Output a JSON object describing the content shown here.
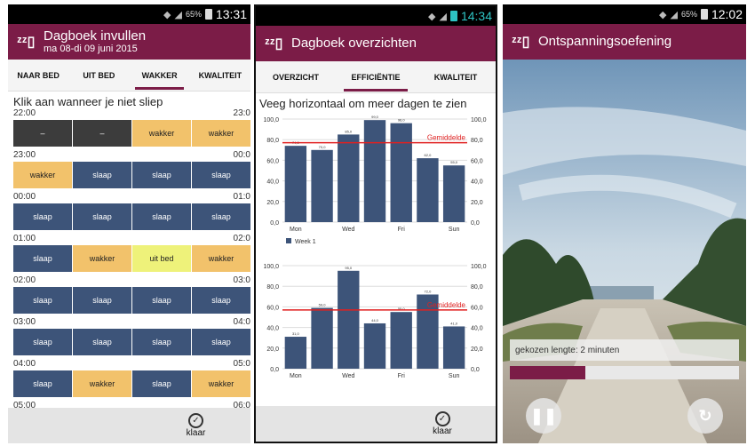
{
  "screen1": {
    "status": {
      "battery_pct": "65%",
      "time": "13:31"
    },
    "appbar": {
      "title": "Dagboek invullen",
      "subtitle": "ma 08-di 09 juni 2015"
    },
    "tabs": [
      "NAAR BED",
      "UIT BED",
      "WAKKER",
      "KWALITEIT"
    ],
    "active_tab": 2,
    "instruction": "Klik aan wanneer je niet sliep",
    "hours": [
      {
        "start": "22:00",
        "end": "23:0",
        "blocks": [
          "–",
          "–",
          "wakker",
          "wakker"
        ]
      },
      {
        "start": "23:00",
        "end": "00:0",
        "blocks": [
          "wakker",
          "slaap",
          "slaap",
          "slaap"
        ]
      },
      {
        "start": "00:00",
        "end": "01:0",
        "blocks": [
          "slaap",
          "slaap",
          "slaap",
          "slaap"
        ]
      },
      {
        "start": "01:00",
        "end": "02:0",
        "blocks": [
          "slaap",
          "wakker",
          "uit bed",
          "wakker"
        ]
      },
      {
        "start": "02:00",
        "end": "03:0",
        "blocks": [
          "slaap",
          "slaap",
          "slaap",
          "slaap"
        ]
      },
      {
        "start": "03:00",
        "end": "04:0",
        "blocks": [
          "slaap",
          "slaap",
          "slaap",
          "slaap"
        ]
      },
      {
        "start": "04:00",
        "end": "05:0",
        "blocks": [
          "slaap",
          "wakker",
          "slaap",
          "wakker"
        ]
      },
      {
        "start": "05:00",
        "end": "06:0",
        "blocks": []
      }
    ],
    "done_label": "klaar"
  },
  "screen2": {
    "status": {
      "time": "14:34"
    },
    "appbar": {
      "title": "Dagboek overzichten"
    },
    "tabs": [
      "OVERZICHT",
      "EFFICIËNTIE",
      "KWALITEIT"
    ],
    "active_tab": 1,
    "instruction": "Veeg horizontaal om meer dagen te zien",
    "done_label": "klaar"
  },
  "chart_data": [
    {
      "type": "bar",
      "categories": [
        "Mon",
        "Tue",
        "Wed",
        "Thu",
        "Fri",
        "Sat",
        "Sun"
      ],
      "tick_labels": [
        "Mon",
        "Wed",
        "Fri",
        "Sun"
      ],
      "series": [
        {
          "name": "Week 1",
          "values": [
            74.0,
            70.0,
            85.0,
            99.0,
            96.0,
            62.0,
            55.0
          ]
        }
      ],
      "value_labels": [
        "74,0",
        "70,0",
        "85,0",
        "99,0",
        "96,0",
        "62,0",
        "55,0"
      ],
      "reference_line": {
        "label": "Gemiddelde",
        "value": 77,
        "color": "#e02020"
      },
      "ylim": [
        0,
        100
      ],
      "yticks": [
        "0,0",
        "20,0",
        "40,0",
        "60,0",
        "80,0",
        "100,0"
      ],
      "grid": true,
      "legend": "bottom-left"
    },
    {
      "type": "bar",
      "categories": [
        "Mon",
        "Tue",
        "Wed",
        "Thu",
        "Fri",
        "Sat",
        "Sun"
      ],
      "tick_labels": [
        "Mon",
        "Wed",
        "Fri",
        "Sun"
      ],
      "series": [
        {
          "values": [
            31.0,
            59.0,
            95.0,
            44.0,
            55.0,
            72.0,
            41.0
          ]
        }
      ],
      "value_labels": [
        "31,0",
        "59,0",
        "95,0",
        "44,0",
        "55,0",
        "72,0",
        "41,0"
      ],
      "reference_line": {
        "label": "Gemiddelde",
        "value": 57,
        "color": "#e02020"
      },
      "ylim": [
        0,
        100
      ],
      "yticks": [
        "0,0",
        "20,0",
        "40,0",
        "60,0",
        "80,0",
        "100,0"
      ],
      "grid": true
    }
  ],
  "screen3": {
    "status": {
      "battery_pct": "65%",
      "time": "12:02"
    },
    "appbar": {
      "title": "Ontspanningsoefening"
    },
    "length_label": "gekozen lengte: 2 minuten",
    "progress": 0.33,
    "colors": {
      "accent": "#7b1c47",
      "bar": "#3d5479"
    }
  }
}
